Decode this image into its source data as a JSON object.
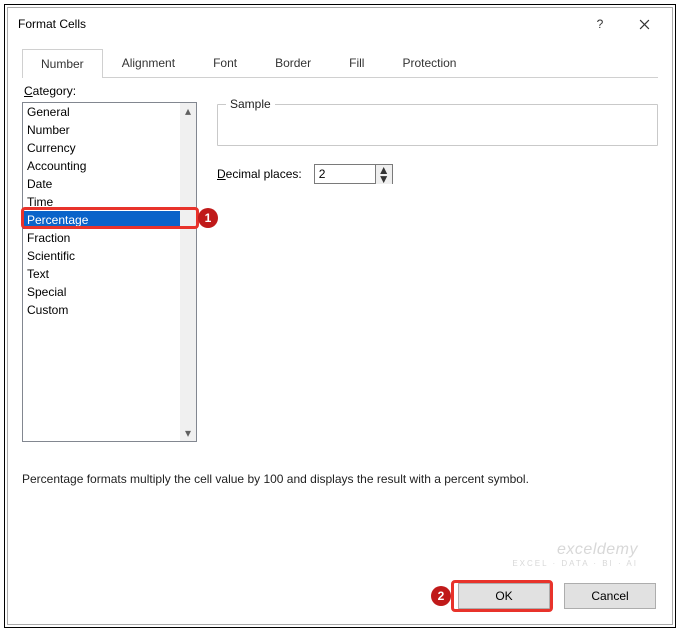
{
  "title": "Format Cells",
  "tabs": [
    "Number",
    "Alignment",
    "Font",
    "Border",
    "Fill",
    "Protection"
  ],
  "activeTabIndex": 0,
  "category": {
    "label_pre": "C",
    "label_post": "ategory:",
    "items": [
      "General",
      "Number",
      "Currency",
      "Accounting",
      "Date",
      "Time",
      "Percentage",
      "Fraction",
      "Scientific",
      "Text",
      "Special",
      "Custom"
    ],
    "selectedIndex": 6
  },
  "sample": {
    "label": "Sample",
    "value": ""
  },
  "decimal": {
    "label_pre": "D",
    "label_post": "ecimal places:",
    "value": "2"
  },
  "description": "Percentage formats multiply the cell value by 100 and displays the result with a percent symbol.",
  "buttons": {
    "ok": "OK",
    "cancel": "Cancel"
  },
  "help": "?",
  "callouts": {
    "one": "1",
    "two": "2"
  },
  "watermark": {
    "line1": "exceldemy",
    "line2": "EXCEL · DATA · BI · AI"
  }
}
